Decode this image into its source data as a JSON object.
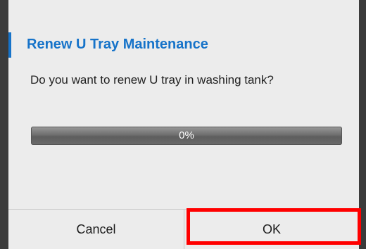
{
  "dialog": {
    "title": "Renew U Tray Maintenance",
    "message": "Do you want to renew U tray in washing tank?",
    "progress": {
      "value_percent": 0,
      "label": "0%"
    },
    "buttons": {
      "cancel_label": "Cancel",
      "ok_label": "OK"
    }
  },
  "colors": {
    "accent": "#1673c9",
    "highlight": "#ff0000"
  }
}
